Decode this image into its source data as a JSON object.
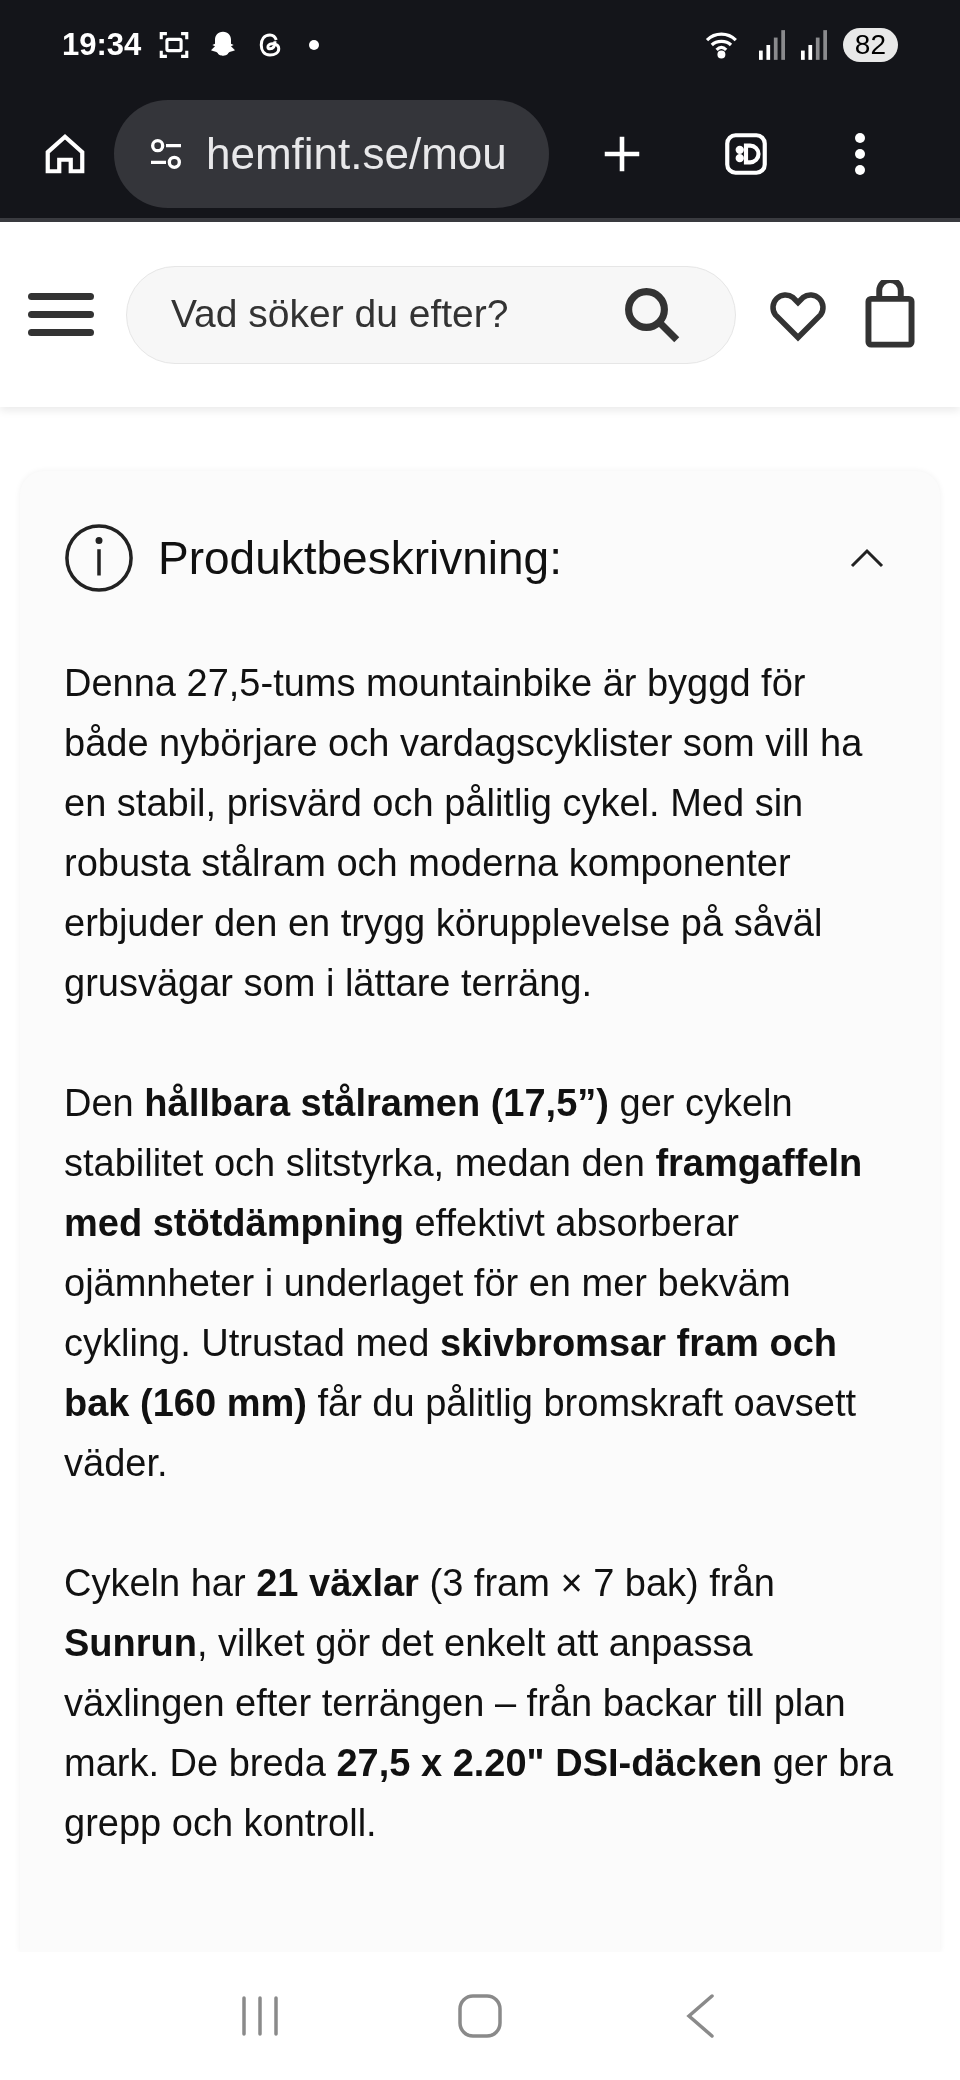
{
  "status_bar": {
    "time": "19:34",
    "battery": "82"
  },
  "browser": {
    "url": "hemfint.se/mou"
  },
  "header": {
    "search": {
      "placeholder": "Vad söker du efter?"
    }
  },
  "section": {
    "title": "Produktbeskrivning:",
    "expanded": true,
    "paragraphs": [
      "Denna 27,5-tums mountainbike är byggd för både nybörjare och vardagscyklister som vill ha en stabil, prisvärd och pålitlig cykel. Med sin robusta stålram och moderna komponenter erbjuder den en trygg körupplevelse på såväl grusvägar som i lättare terräng.",
      "Den **hållbara stålramen (17,5”)** ger cykeln stabilitet och slitstyrka, medan den **framgaffeln med stötdämpning** effektivt absorberar ojämnheter i underlaget för en mer bekväm cykling. Utrustad med **skivbromsar fram och bak (160 mm)** får du pålitlig bromskraft oavsett väder.",
      "Cykeln har **21 växlar** (3 fram × 7 bak) från **Sunrun**, vilket gör det enkelt att anpassa växlingen efter terrängen – från backar till plan mark. De breda **27,5 x 2.20\" DSI-däcken** ger bra grepp och kontroll."
    ]
  }
}
